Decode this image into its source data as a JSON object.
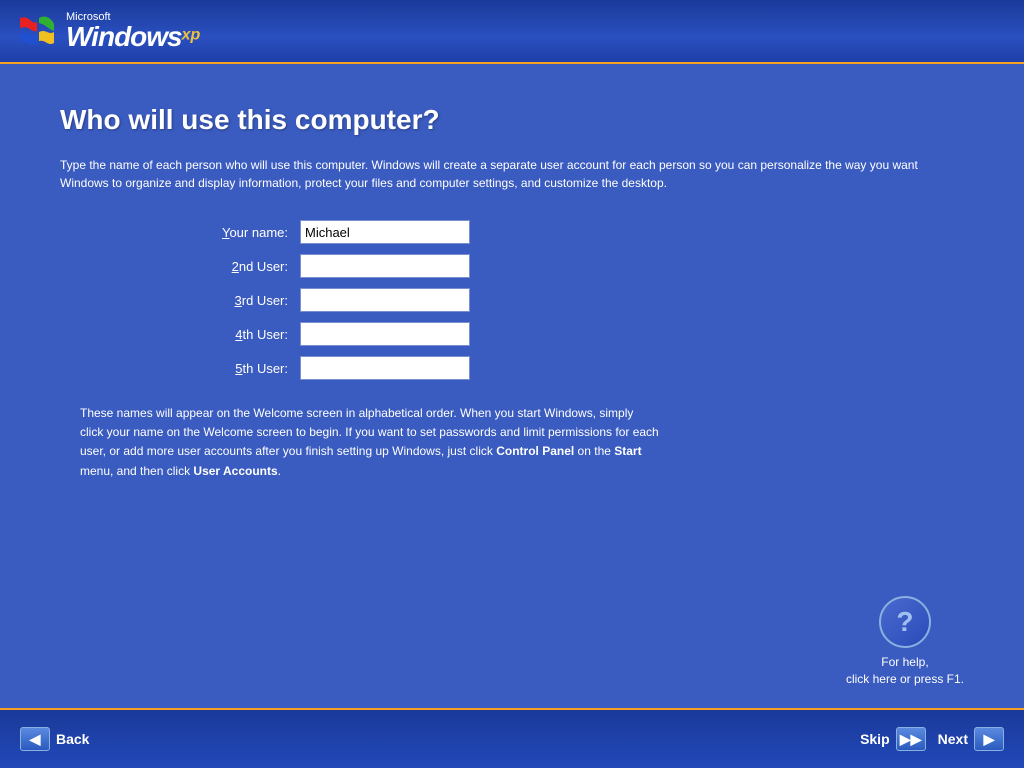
{
  "header": {
    "microsoft_label": "Microsoft",
    "windows_label": "Windows",
    "xp_label": "xp"
  },
  "page": {
    "title": "Who will use this computer?",
    "description": "Type the name of each person who will use this computer. Windows will create a separate user account for each person so you can personalize the way you want Windows to organize and display information, protect your files and computer settings, and customize the desktop.",
    "footer_note_1": "These names will appear on the Welcome screen in alphabetical order. When you start Windows, simply click your name on the Welcome screen to begin. If you want to set passwords and limit permissions for each user, or add more user accounts after you finish setting up Windows, just click ",
    "footer_bold_1": "Control Panel",
    "footer_note_2": " on the ",
    "footer_bold_2": "Start",
    "footer_note_3": " menu, and then click ",
    "footer_bold_3": "User Accounts",
    "footer_note_4": "."
  },
  "form": {
    "fields": [
      {
        "label_prefix": "",
        "underline": "Y",
        "label_suffix": "our name:",
        "value": "Michael",
        "placeholder": ""
      },
      {
        "label_prefix": "",
        "underline": "2",
        "label_suffix": "nd User:",
        "value": "",
        "placeholder": ""
      },
      {
        "label_prefix": "",
        "underline": "3",
        "label_suffix": "rd User:",
        "value": "",
        "placeholder": ""
      },
      {
        "label_prefix": "",
        "underline": "4",
        "label_suffix": "th User:",
        "value": "",
        "placeholder": ""
      },
      {
        "label_prefix": "",
        "underline": "5",
        "label_suffix": "th User:",
        "value": "",
        "placeholder": ""
      }
    ]
  },
  "help": {
    "icon": "?",
    "text_line1": "For help,",
    "text_line2": "click here or press F1."
  },
  "nav": {
    "back_label": "Back",
    "skip_label": "Skip",
    "next_label": "Next"
  }
}
